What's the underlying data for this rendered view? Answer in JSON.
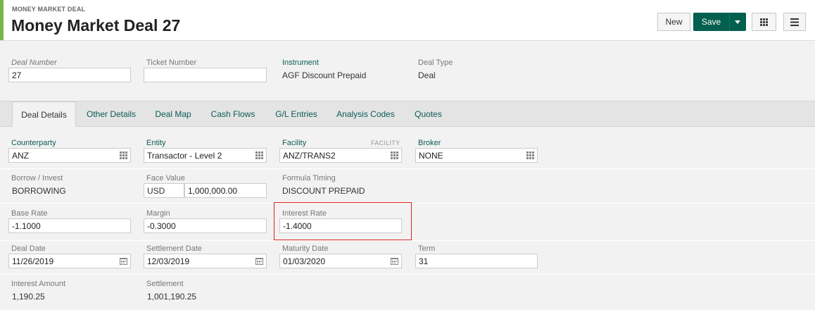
{
  "header": {
    "kicker": "MONEY MARKET DEAL",
    "title": "Money Market Deal 27",
    "new_label": "New",
    "save_label": "Save",
    "accent_color": "#7ab648",
    "save_color": "#035f4e"
  },
  "top": {
    "deal_number": {
      "label": "Deal Number",
      "value": "27"
    },
    "ticket_number": {
      "label": "Ticket Number",
      "value": ""
    },
    "instrument": {
      "label": "Instrument",
      "value": "AGF Discount Prepaid"
    },
    "deal_type": {
      "label": "Deal Type",
      "value": "Deal"
    }
  },
  "tabs": [
    {
      "label": "Deal Details",
      "active": true
    },
    {
      "label": "Other Details"
    },
    {
      "label": "Deal Map"
    },
    {
      "label": "Cash Flows"
    },
    {
      "label": "G/L Entries"
    },
    {
      "label": "Analysis Codes"
    },
    {
      "label": "Quotes"
    }
  ],
  "details": {
    "counterparty": {
      "label": "Counterparty",
      "value": "ANZ",
      "icon": "grid-picker-icon"
    },
    "entity": {
      "label": "Entity",
      "value": "Transactor - Level 2",
      "icon": "grid-picker-icon"
    },
    "facility": {
      "label": "Facility",
      "tag": "FACILITY",
      "value": "ANZ/TRANS2",
      "icon": "grid-picker-icon"
    },
    "broker": {
      "label": "Broker",
      "value": "NONE",
      "icon": "grid-picker-icon"
    },
    "borrow_invest": {
      "label": "Borrow / Invest",
      "value": "BORROWING"
    },
    "face_value": {
      "label": "Face Value",
      "currency": "USD",
      "value": "1,000,000.00"
    },
    "formula_timing": {
      "label": "Formula Timing",
      "value": "DISCOUNT PREPAID"
    },
    "base_rate": {
      "label": "Base Rate",
      "value": "-1.1000"
    },
    "margin": {
      "label": "Margin",
      "value": "-0.3000"
    },
    "interest_rate": {
      "label": "Interest Rate",
      "value": "-1.4000",
      "highlight_color": "#dd2222"
    },
    "deal_date": {
      "label": "Deal Date",
      "value": "11/26/2019",
      "icon": "calendar-icon"
    },
    "settlement_date": {
      "label": "Settlement Date",
      "value": "12/03/2019",
      "icon": "calendar-icon"
    },
    "maturity_date": {
      "label": "Maturity Date",
      "value": "01/03/2020",
      "icon": "calendar-icon"
    },
    "term": {
      "label": "Term",
      "value": "31"
    },
    "interest_amount": {
      "label": "Interest Amount",
      "value": "1,190.25"
    },
    "settlement": {
      "label": "Settlement",
      "value": "1,001,190.25"
    }
  }
}
